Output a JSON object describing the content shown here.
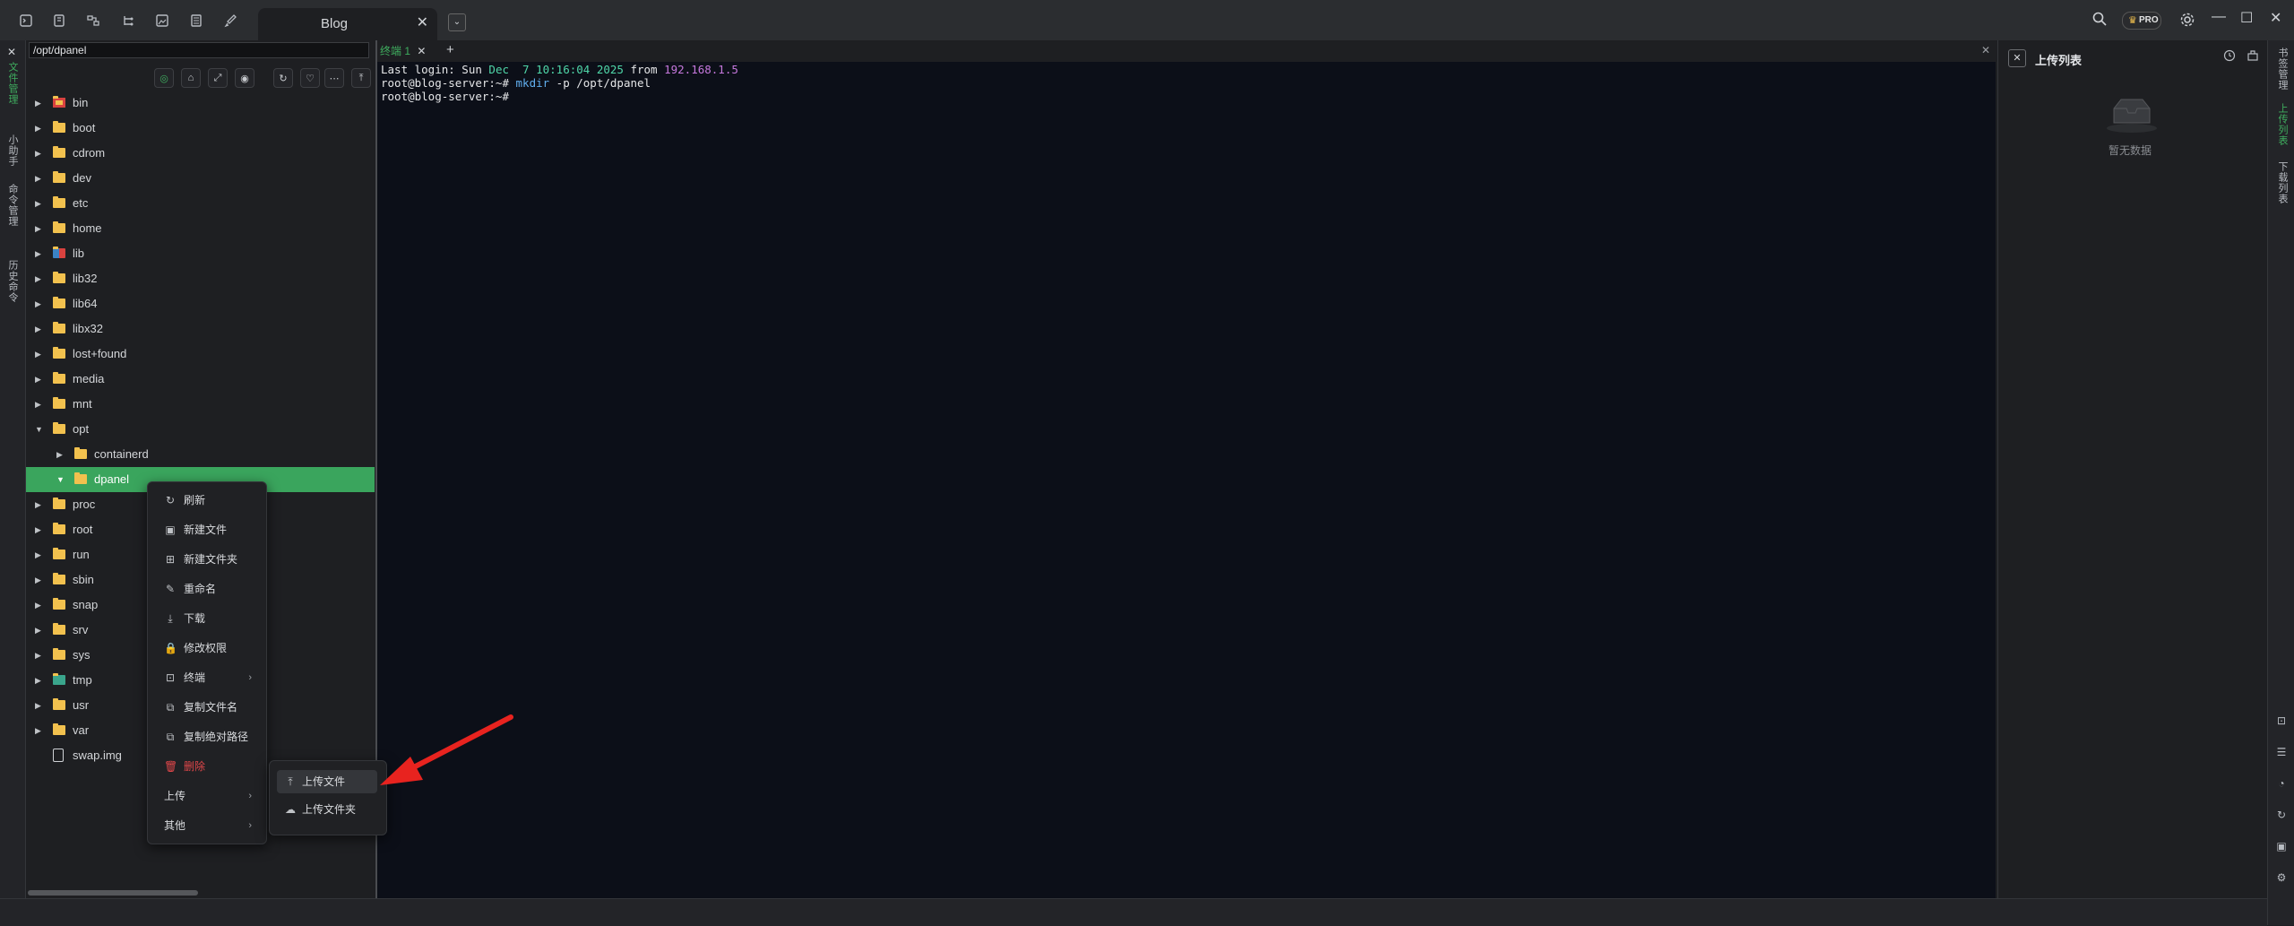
{
  "titlebar": {
    "tab_title": "Blog",
    "close_glyph": "✕",
    "dropdown_glyph": "⌄",
    "pro_badge": "PRO",
    "minimize": "—",
    "maximize": "☐",
    "close": "✕"
  },
  "left_strip": {
    "close_glyph": "✕",
    "items": [
      "文件管理",
      "小助手",
      "命令管理",
      "历史命令"
    ]
  },
  "file_panel": {
    "path": "/opt/dpanel",
    "tree": [
      {
        "name": "bin",
        "depth": 0,
        "expanded": false,
        "icon": "folder-red-icon"
      },
      {
        "name": "boot",
        "depth": 0,
        "expanded": false,
        "icon": "folder-icon"
      },
      {
        "name": "cdrom",
        "depth": 0,
        "expanded": false,
        "icon": "folder-icon"
      },
      {
        "name": "dev",
        "depth": 0,
        "expanded": false,
        "icon": "folder-icon"
      },
      {
        "name": "etc",
        "depth": 0,
        "expanded": false,
        "icon": "folder-icon"
      },
      {
        "name": "home",
        "depth": 0,
        "expanded": false,
        "icon": "folder-icon"
      },
      {
        "name": "lib",
        "depth": 0,
        "expanded": false,
        "icon": "folder-lib-icon"
      },
      {
        "name": "lib32",
        "depth": 0,
        "expanded": false,
        "icon": "folder-icon"
      },
      {
        "name": "lib64",
        "depth": 0,
        "expanded": false,
        "icon": "folder-icon"
      },
      {
        "name": "libx32",
        "depth": 0,
        "expanded": false,
        "icon": "folder-icon"
      },
      {
        "name": "lost+found",
        "depth": 0,
        "expanded": false,
        "icon": "folder-icon"
      },
      {
        "name": "media",
        "depth": 0,
        "expanded": false,
        "icon": "folder-icon"
      },
      {
        "name": "mnt",
        "depth": 0,
        "expanded": false,
        "icon": "folder-icon"
      },
      {
        "name": "opt",
        "depth": 0,
        "expanded": true,
        "icon": "folder-icon"
      },
      {
        "name": "containerd",
        "depth": 1,
        "expanded": false,
        "icon": "folder-icon"
      },
      {
        "name": "dpanel",
        "depth": 1,
        "expanded": true,
        "icon": "folder-icon",
        "selected": true
      },
      {
        "name": "proc",
        "depth": 0,
        "expanded": false,
        "icon": "folder-icon"
      },
      {
        "name": "root",
        "depth": 0,
        "expanded": false,
        "icon": "folder-icon"
      },
      {
        "name": "run",
        "depth": 0,
        "expanded": false,
        "icon": "folder-icon"
      },
      {
        "name": "sbin",
        "depth": 0,
        "expanded": false,
        "icon": "folder-icon"
      },
      {
        "name": "snap",
        "depth": 0,
        "expanded": false,
        "icon": "folder-icon"
      },
      {
        "name": "srv",
        "depth": 0,
        "expanded": false,
        "icon": "folder-icon"
      },
      {
        "name": "sys",
        "depth": 0,
        "expanded": false,
        "icon": "folder-icon"
      },
      {
        "name": "tmp",
        "depth": 0,
        "expanded": false,
        "icon": "folder-tmp-icon"
      },
      {
        "name": "usr",
        "depth": 0,
        "expanded": false,
        "icon": "folder-icon"
      },
      {
        "name": "var",
        "depth": 0,
        "expanded": false,
        "icon": "folder-icon"
      },
      {
        "name": "swap.img",
        "depth": 0,
        "expanded": null,
        "icon": "file-icon"
      }
    ]
  },
  "terminal": {
    "tab_label": "终端 1",
    "tab_close": "✕",
    "add_tab": "+",
    "close_panel": "✕",
    "lines": [
      {
        "parts": [
          {
            "text": "Last login: Sun ",
            "color": "#e5e6e8"
          },
          {
            "text": "Dec  7 10:16:04 2025",
            "color": "#4fd6a8"
          },
          {
            "text": " from ",
            "color": "#e5e6e8"
          },
          {
            "text": "192.168.1.5",
            "color": "#c678dd"
          }
        ]
      },
      {
        "parts": [
          {
            "text": "root@blog-server:~# ",
            "color": "#e5e6e8"
          },
          {
            "text": "mkdir",
            "color": "#61afef"
          },
          {
            "text": " -p /opt/dpanel",
            "color": "#e5e6e8"
          }
        ]
      },
      {
        "parts": [
          {
            "text": "root@blog-server:~#",
            "color": "#e5e6e8"
          }
        ]
      }
    ]
  },
  "right_panel": {
    "title": "上传列表",
    "close_glyph": "✕",
    "empty_text": "暂无数据"
  },
  "right_strip": {
    "items": [
      "书签管理",
      "上传列表",
      "下载列表"
    ]
  },
  "context_menu": {
    "items": [
      {
        "label": "刷新",
        "icon": "refresh-icon",
        "glyph": "↻"
      },
      {
        "label": "新建文件",
        "icon": "new-file-icon",
        "glyph": "▣"
      },
      {
        "label": "新建文件夹",
        "icon": "new-folder-icon",
        "glyph": "⊞"
      },
      {
        "label": "重命名",
        "icon": "edit-icon",
        "glyph": "✎"
      },
      {
        "label": "下载",
        "icon": "download-icon",
        "glyph": "⤓"
      },
      {
        "label": "修改权限",
        "icon": "lock-icon",
        "glyph": "🔒"
      },
      {
        "label": "终端",
        "icon": "terminal-icon",
        "glyph": "⊡",
        "submenu": true
      },
      {
        "label": "复制文件名",
        "icon": "copy-icon",
        "glyph": "⧉"
      },
      {
        "label": "复制绝对路径",
        "icon": "copy-path-icon",
        "glyph": "⧉"
      },
      {
        "label": "删除",
        "icon": "trash-icon",
        "glyph": "🗑",
        "danger": true
      },
      {
        "label": "上传",
        "icon": "",
        "glyph": "",
        "submenu": true
      },
      {
        "label": "其他",
        "icon": "",
        "glyph": "",
        "submenu": true
      }
    ],
    "submenu_arrow": "›"
  },
  "upload_submenu": {
    "items": [
      {
        "label": "上传文件",
        "icon": "upload-icon",
        "glyph": "⤒",
        "hover": true
      },
      {
        "label": "上传文件夹",
        "icon": "cloud-upload-icon",
        "glyph": "☁"
      }
    ]
  },
  "annotation": {
    "arrow_color": "#e8231f"
  },
  "colors": {
    "accent": "#3aa55d",
    "danger": "#e0474a"
  }
}
